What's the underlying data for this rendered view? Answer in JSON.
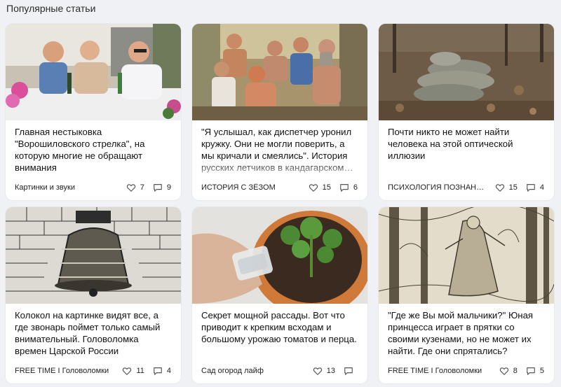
{
  "section_title": "Популярные статьи",
  "cards": [
    {
      "title": "Главная нестыковка \"Ворошиловского стрелка\", на которую многие не обращают внимания",
      "source": "Картинки и звуки",
      "likes": "7",
      "comments": "9"
    },
    {
      "title": "\"Я услышал, как диспетчер уронил кружку. Они не могли поверить, а мы кричали и смеялись\". История русских летчиков в кандагарском плену",
      "source": "ИСТОРИЯ С ЗЁЗОМ",
      "likes": "15",
      "comments": "6"
    },
    {
      "title": "Почти никто не может найти человека на этой оптической иллюзии",
      "source": "ПСИХОЛОГИЯ ПОЗНАНИЯ",
      "likes": "15",
      "comments": "4"
    },
    {
      "title": "Колокол на картинке видят все, а где звонарь поймет только самый внимательный. Головоломка времен Царской России",
      "source": "FREE TIME I Головоломки",
      "likes": "11",
      "comments": "4"
    },
    {
      "title": "Секрет мощной рассады. Вот что приводит к крепким всходам и большому урожаю томатов и перца.",
      "source": "Сад огород лайф",
      "likes": "13",
      "comments": ""
    },
    {
      "title": "\"Где же Вы мой мальчики?\" Юная принцесса играет в прятки со своими кузенами, но не может их найти. Где они спрятались?",
      "source": "FREE TIME I Головоломки",
      "likes": "8",
      "comments": "5"
    }
  ]
}
